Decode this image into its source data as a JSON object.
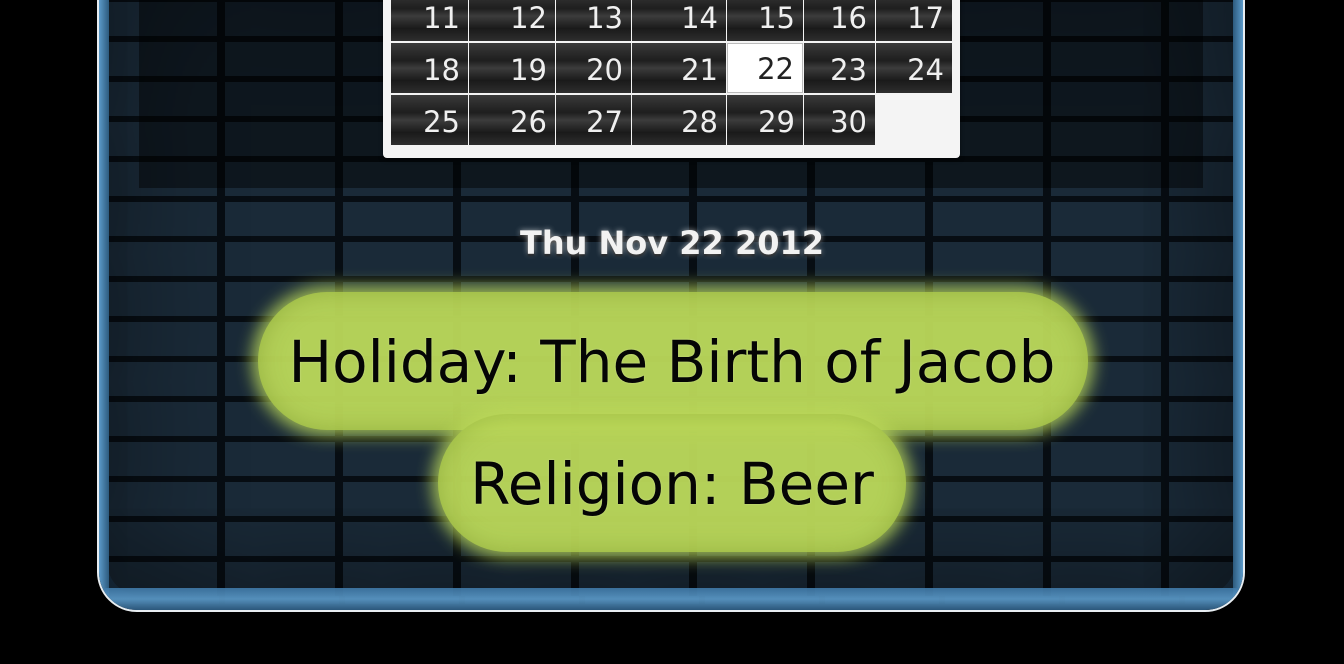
{
  "calendar": {
    "rows": [
      [
        "11",
        "12",
        "13",
        "14",
        "15",
        "16",
        "17"
      ],
      [
        "18",
        "19",
        "20",
        "21",
        "22",
        "23",
        "24"
      ],
      [
        "25",
        "26",
        "27",
        "28",
        "29",
        "30",
        ""
      ]
    ],
    "selected_day": "22"
  },
  "date_heading": "Thu Nov 22 2012",
  "holiday_text": "Holiday: The Birth of Jacob",
  "religion_text": "Religion: Beer",
  "colors": {
    "highlight_green": "#bcd95a",
    "wall_blue": "#223445",
    "background": "#000000"
  }
}
